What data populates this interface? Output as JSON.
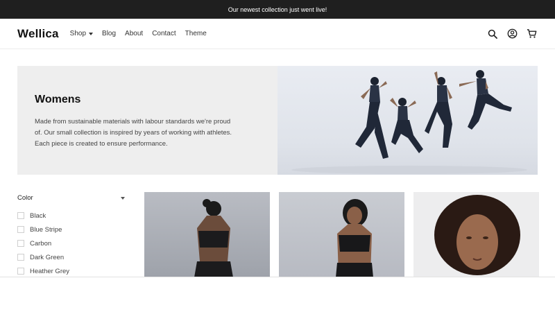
{
  "announcement": {
    "text": "Our newest collection just went live!"
  },
  "header": {
    "logo": "Wellica",
    "nav": [
      {
        "label": "Shop",
        "has_dropdown": true
      },
      {
        "label": "Blog"
      },
      {
        "label": "About"
      },
      {
        "label": "Contact"
      },
      {
        "label": "Theme"
      }
    ],
    "icons": [
      "search-icon",
      "account-icon",
      "cart-icon"
    ]
  },
  "hero": {
    "title": "Womens",
    "description": "Made from sustainable materials with labour standards we're proud of. Our small collection is inspired by years of working with athletes. Each piece is created to ensure performance."
  },
  "filter": {
    "title": "Color",
    "options": [
      "Black",
      "Blue Stripe",
      "Carbon",
      "Dark Green",
      "Heather Grey"
    ]
  },
  "colors": {
    "announcement_bg": "#1f1f1f",
    "hero_text_bg": "#eeeeee",
    "accent": "#111111"
  }
}
